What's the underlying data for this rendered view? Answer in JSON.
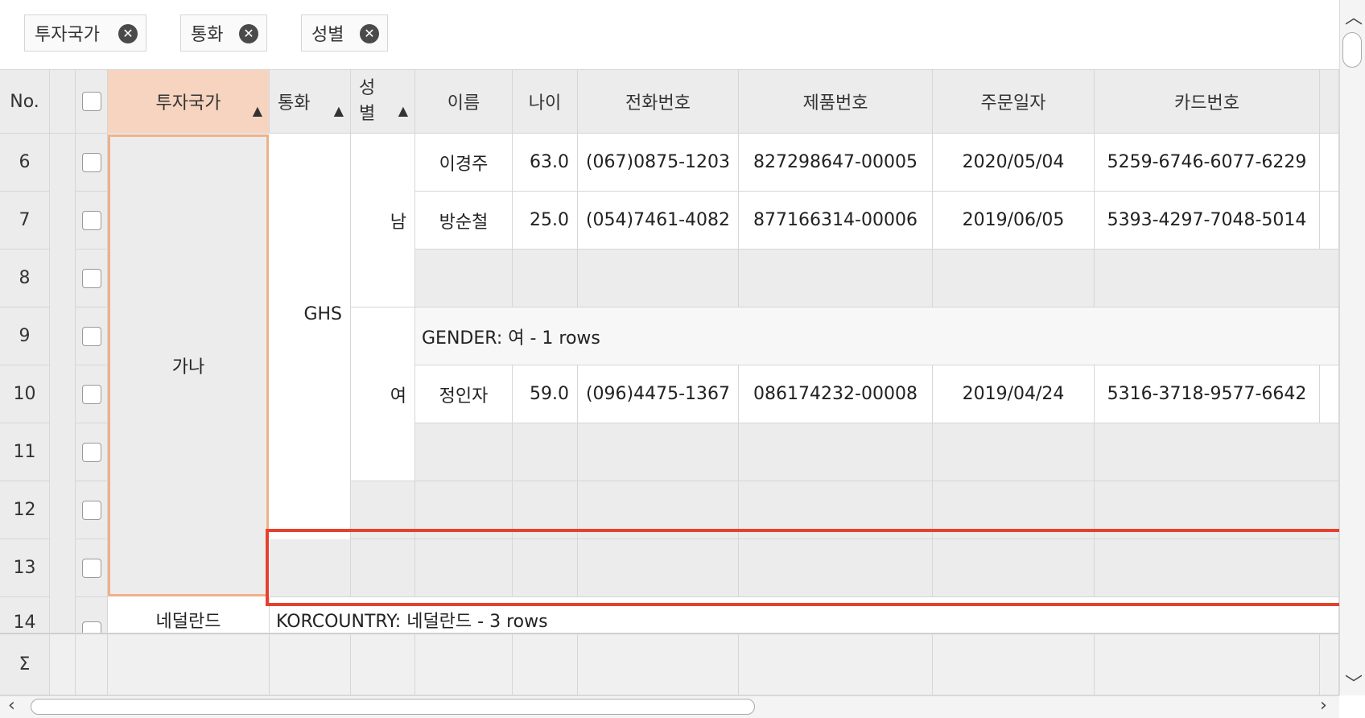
{
  "groupChips": [
    {
      "label": "투자국가"
    },
    {
      "label": "통화"
    },
    {
      "label": "성별"
    }
  ],
  "headers": {
    "no": "No.",
    "country": "투자국가",
    "currency": "통화",
    "gender": "성\n별",
    "name": "이름",
    "age": "나이",
    "phone": "전화번호",
    "product": "제품번호",
    "orderDate": "주문일자",
    "card": "카드번호"
  },
  "rowNumbers": [
    "6",
    "7",
    "8",
    "9",
    "10",
    "11",
    "12",
    "13",
    "14"
  ],
  "sumLabel": "Σ",
  "groupCells": {
    "country": "가나",
    "currency": "GHS",
    "genderMale": "남",
    "genderFemale": "여",
    "nextCountry": "네덜란드"
  },
  "groupRows": {
    "female": "GENDER: 여 - 1 rows",
    "netherlands": "KORCOUNTRY: 네덜란드 - 3 rows"
  },
  "dataRows": [
    {
      "name": "이경주",
      "age": "63.0",
      "phone": "(067)0875-1203",
      "product": "827298647-00005",
      "orderDate": "2020/05/04",
      "card": "5259-6746-6077-6229"
    },
    {
      "name": "방순철",
      "age": "25.0",
      "phone": "(054)7461-4082",
      "product": "877166314-00006",
      "orderDate": "2019/06/05",
      "card": "5393-4297-7048-5014"
    },
    {
      "name": "정인자",
      "age": "59.0",
      "phone": "(096)4475-1367",
      "product": "086174232-00008",
      "orderDate": "2019/04/24",
      "card": "5316-3718-9577-6642"
    }
  ],
  "icons": {
    "remove": "close-icon",
    "sortAsc": "sort-up-icon"
  },
  "colors": {
    "selectedHeader": "#f7d4bf",
    "highlightBorder": "#e5412d",
    "groupBorder": "#f0b088"
  }
}
